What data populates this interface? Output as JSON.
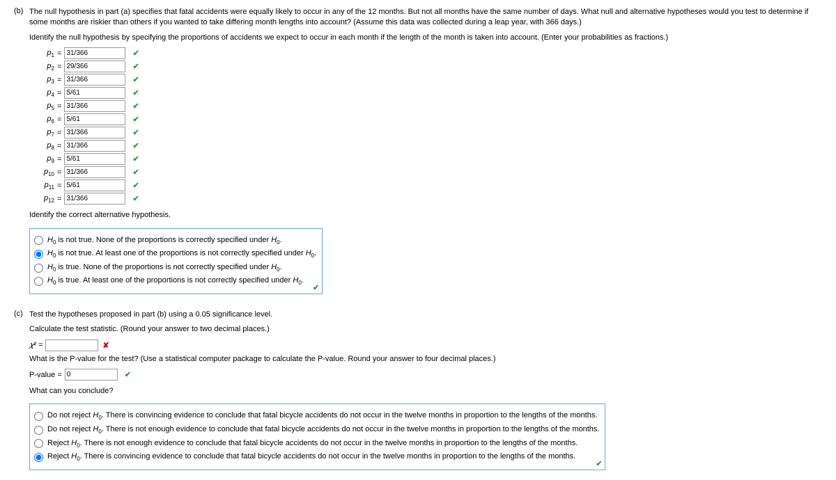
{
  "partB": {
    "label": "(b)",
    "intro": "The null hypothesis in part (a) specifies that fatal accidents were equally likely to occur in any of the 12 months. But not all months have the same number of days. What null and alternative hypotheses would you test to determine if some months are riskier than others if you wanted to take differing month lengths into account? (Assume this data was collected during a leap year, with 366 days.)",
    "identify": "Identify the null hypothesis by specifying the proportions of accidents we expect to occur in each month if the length of the month is taken into account. (Enter your probabilities as fractions.)",
    "props": [
      {
        "label": "p",
        "sub": "1",
        "value": "31/366"
      },
      {
        "label": "p",
        "sub": "2",
        "value": "29/366"
      },
      {
        "label": "p",
        "sub": "3",
        "value": "31/366"
      },
      {
        "label": "p",
        "sub": "4",
        "value": "5/61"
      },
      {
        "label": "p",
        "sub": "5",
        "value": "31/366"
      },
      {
        "label": "p",
        "sub": "6",
        "value": "5/61"
      },
      {
        "label": "p",
        "sub": "7",
        "value": "31/366"
      },
      {
        "label": "p",
        "sub": "8",
        "value": "31/366"
      },
      {
        "label": "p",
        "sub": "9",
        "value": "5/61"
      },
      {
        "label": "p",
        "sub": "10",
        "value": "31/366"
      },
      {
        "label": "p",
        "sub": "11",
        "value": "5/61"
      },
      {
        "label": "p",
        "sub": "12",
        "value": "31/366"
      }
    ],
    "altPrompt": "Identify the correct alternative hypothesis.",
    "altOptions": [
      {
        "pre": "H",
        "sub": "0",
        "post": " is not true. None of the proportions is correctly specified under ",
        "pre2": "H",
        "sub2": "0",
        "post2": "."
      },
      {
        "pre": "H",
        "sub": "0",
        "post": " is not true. At least one of the proportions is not correctly specified under ",
        "pre2": "H",
        "sub2": "0",
        "post2": "."
      },
      {
        "pre": "H",
        "sub": "0",
        "post": " is true. None of the proportions is not correctly specified under ",
        "pre2": "H",
        "sub2": "0",
        "post2": "."
      },
      {
        "pre": "H",
        "sub": "0",
        "post": " is true. At least one of the proportions is not correctly specified under ",
        "pre2": "H",
        "sub2": "0",
        "post2": "."
      }
    ],
    "altSelected": 1
  },
  "partC": {
    "label": "(c)",
    "intro": "Test the hypotheses proposed in part (b) using a 0.05 significance level.",
    "calc": "Calculate the test statistic. (Round your answer to two decimal places.)",
    "chiLabel": "𝜒² =",
    "chiValue": "",
    "pvalPrompt": "What is the P-value for the test? (Use a statistical computer package to calculate the P-value. Round your answer to four decimal places.)",
    "pvalLabel": "P-value =",
    "pvalValue": "0",
    "concludePrompt": "What can you conclude?",
    "concludeOptions": [
      {
        "a": "Do not reject ",
        "b": "There is convincing evidence to conclude that fatal bicycle accidents do not occur in the twelve months in proportion to the lengths of the months."
      },
      {
        "a": "Do not reject ",
        "b": "There is not enough evidence to conclude that fatal bicycle accidents do not occur in the twelve months in proportion to the lengths of the months."
      },
      {
        "a": "Reject ",
        "b": "There is not enough evidence to conclude that fatal bicycle accidents do not occur in the twelve months in proportion to the lengths of the months."
      },
      {
        "a": "Reject ",
        "b": "There is convincing evidence to conclude that fatal bicycle accidents do not occur in the twelve months in proportion to the lengths of the months."
      }
    ],
    "concludeSelected": 3,
    "h0": {
      "sym": "H",
      "sub": "0",
      "dot": ". "
    }
  }
}
